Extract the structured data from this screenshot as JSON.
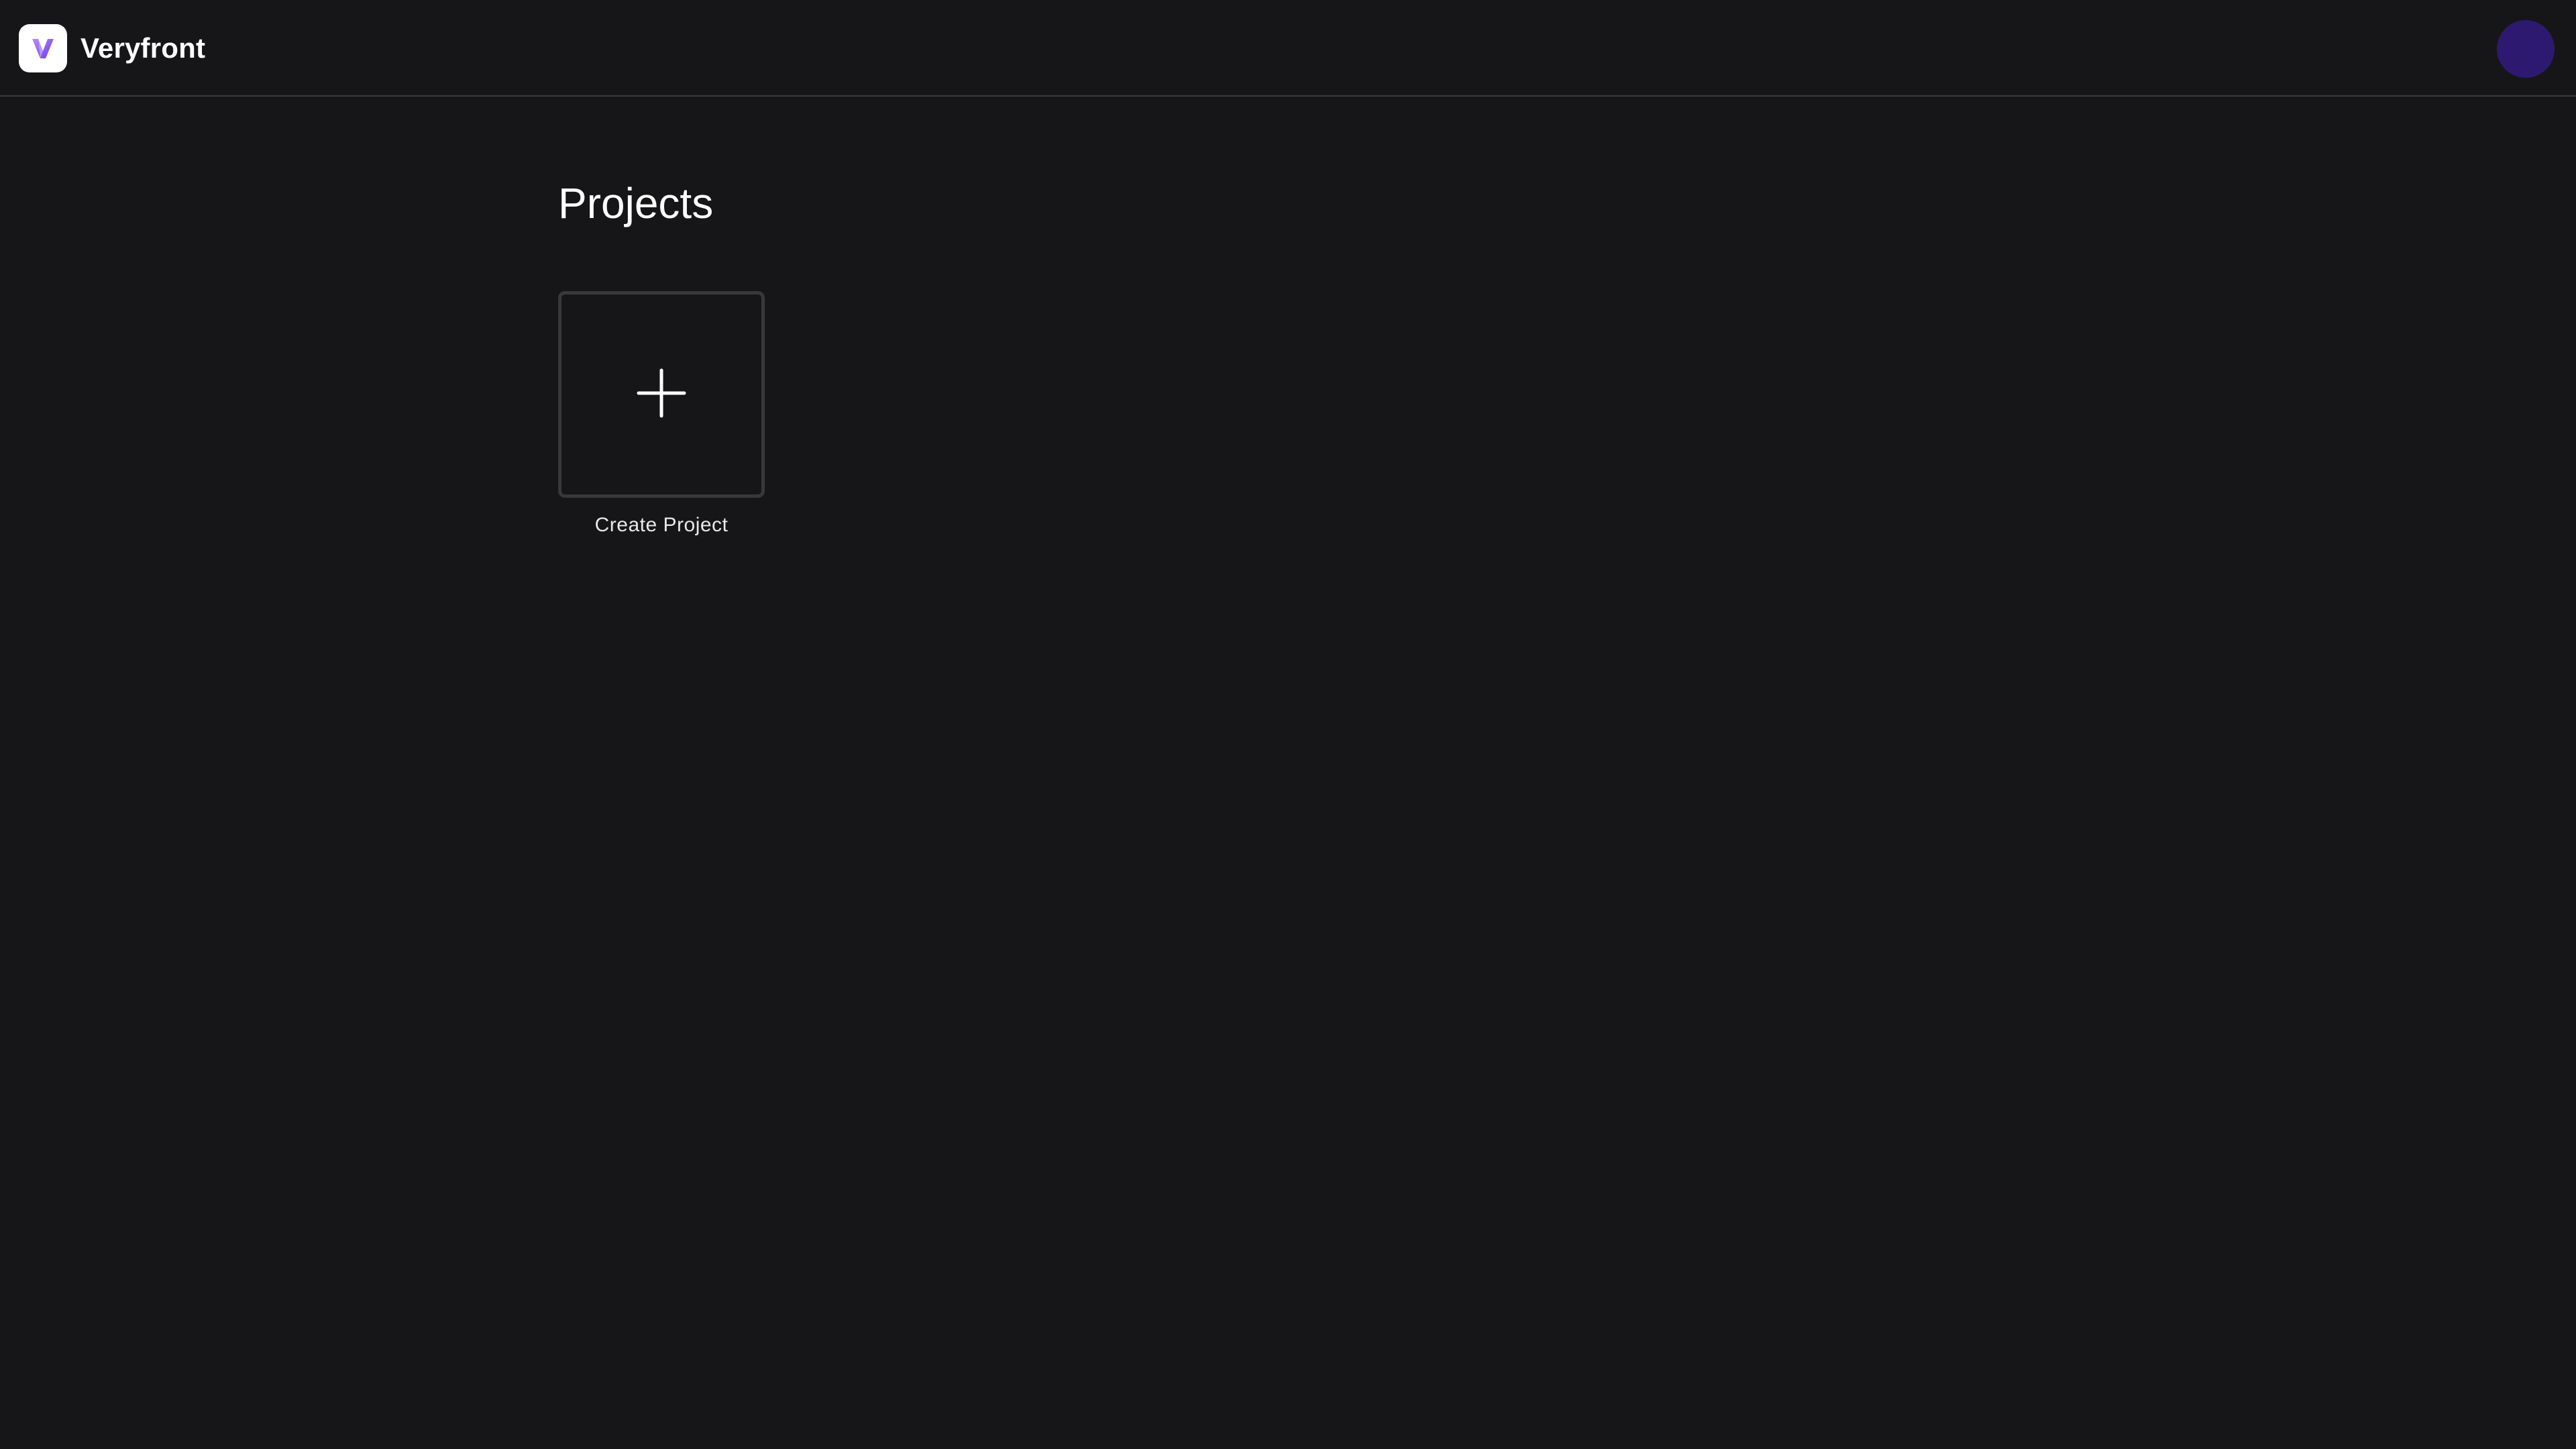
{
  "header": {
    "app_name": "Veryfront",
    "logo_icon": "veryfront-logo-icon",
    "avatar_color": "#2d1a70"
  },
  "main": {
    "title": "Projects",
    "create_card": {
      "icon": "plus-icon",
      "label": "Create Project"
    }
  },
  "colors": {
    "background": "#161618",
    "border": "#38383b",
    "text": "#ffffff",
    "logo_gradient_start": "#8b5cf6",
    "logo_gradient_end": "#c084fc"
  }
}
